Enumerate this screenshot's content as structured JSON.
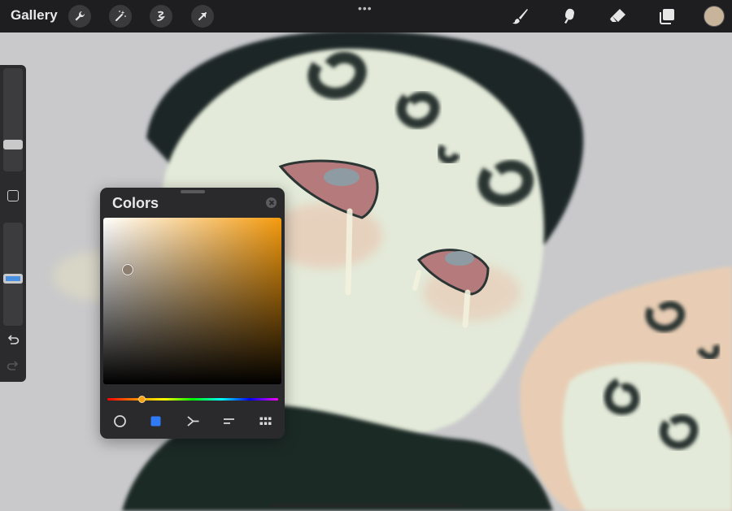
{
  "app": {
    "gallery_label": "Gallery",
    "more_label": "•••"
  },
  "toolbar_left": [
    {
      "name": "wrench-icon",
      "label": "Actions"
    },
    {
      "name": "magic-wand-icon",
      "label": "Adjustments"
    },
    {
      "name": "selection-icon",
      "label": "Selection"
    },
    {
      "name": "arrow-cursor-icon",
      "label": "Transform"
    }
  ],
  "toolbar_right": [
    {
      "name": "brush-icon",
      "label": "Paint"
    },
    {
      "name": "smudge-icon",
      "label": "Smudge"
    },
    {
      "name": "eraser-icon",
      "label": "Erase"
    },
    {
      "name": "layers-icon",
      "label": "Layers"
    }
  ],
  "current_color": "#c8b49a",
  "sidebar": {
    "brush_size": 0.22,
    "brush_opacity": 0.45,
    "accent": "#4a90e2"
  },
  "colors_panel": {
    "title": "Colors",
    "hue_color": "#f59b0e",
    "picker_color": "#8e7e70",
    "modes": [
      "disc-icon",
      "classic-icon",
      "harmony-icon",
      "value-icon",
      "palettes-icon"
    ],
    "active_mode": "classic-icon",
    "active_color": "#2f7bf6"
  }
}
